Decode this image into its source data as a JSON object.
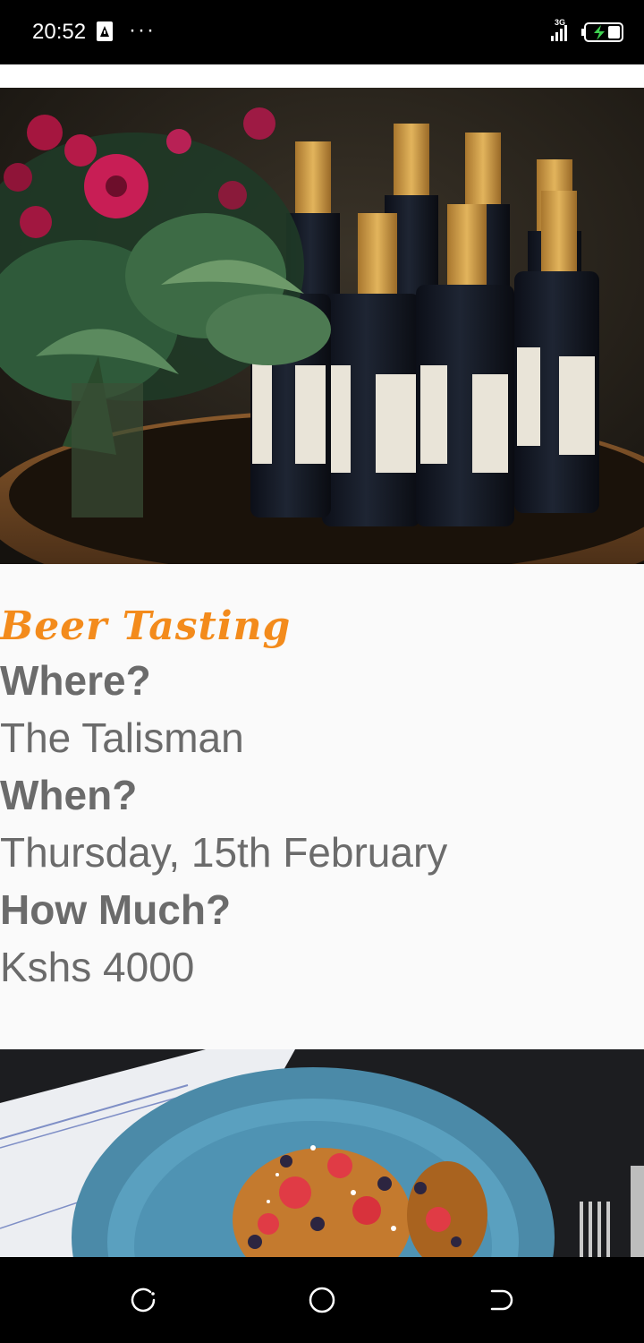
{
  "status_bar": {
    "time": "20:52",
    "overflow_dots": "···",
    "network_type": "3G",
    "icons": [
      "alert-notification-icon",
      "signal-icon",
      "battery-charging-icon"
    ]
  },
  "event": {
    "image_alt": "wine-bottles-and-flowers-photo",
    "title": "Beer Tasting",
    "where_label": "Where?",
    "where_value": "The Talisman",
    "when_label": "When?",
    "when_value": "Thursday, 15th February",
    "price_label": "How Much?",
    "price_value": "Kshs 4000"
  },
  "next_event": {
    "image_alt": "pancakes-with-berries-photo"
  },
  "nav_bar": {
    "icons": [
      "recent-apps-icon",
      "home-icon",
      "back-icon"
    ]
  },
  "colors": {
    "title_accent": "#f38b1c",
    "body_text": "#6b6b6b",
    "background": "#fafafa",
    "system_bars": "#000000"
  }
}
